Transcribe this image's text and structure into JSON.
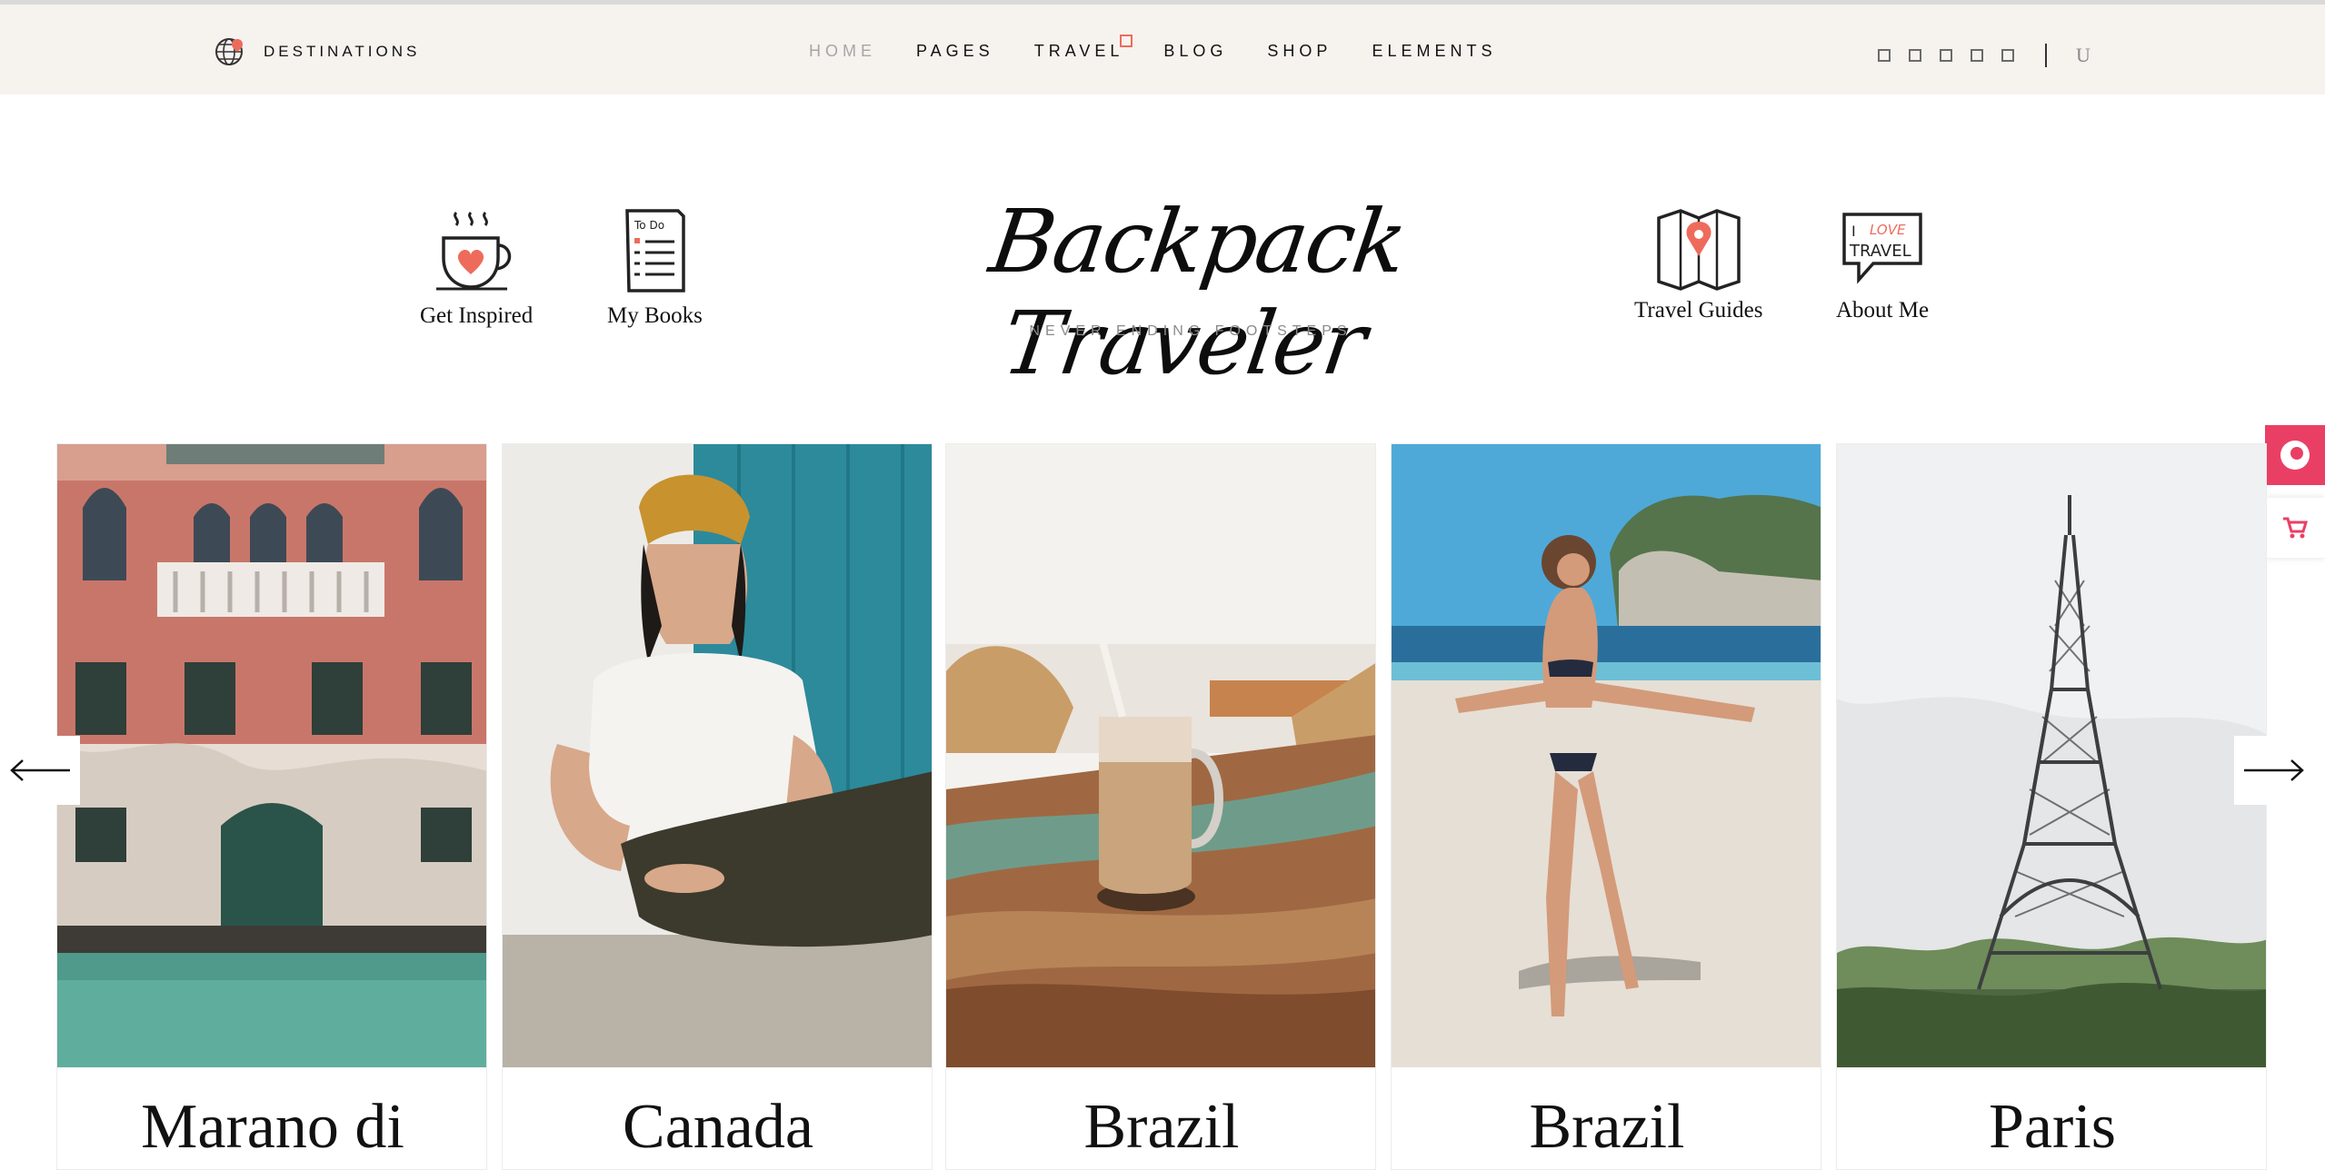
{
  "topbar": {
    "destinations_label": "DESTINATIONS",
    "nav": [
      "HOME",
      "PAGES",
      "TRAVEL",
      "BLOG",
      "SHOP",
      "ELEMENTS"
    ],
    "active_nav": "HOME",
    "social_icons": [
      "square-icon",
      "square-icon",
      "square-icon",
      "square-icon",
      "square-icon"
    ],
    "user_glyph": "U"
  },
  "header": {
    "quick_links": [
      "Get Inspired",
      "My Books",
      "Travel Guides",
      "About Me"
    ],
    "logo_text": "Backpack Traveler",
    "tagline": "NEVER ENDING FOOTSTEPS",
    "icon_texts": {
      "todo": "To Do",
      "love_line1": "I",
      "love_line2": "LOVE",
      "love_line3": "TRAVEL"
    }
  },
  "carousel": {
    "cards": [
      "Marano di",
      "Canada",
      "Brazil",
      "Brazil",
      "Paris"
    ],
    "prev_icon": "arrow-left-icon",
    "next_icon": "arrow-right-icon"
  },
  "side": {
    "icons": [
      "chat-icon",
      "cart-icon"
    ]
  },
  "colors": {
    "accent": "#ea3f64",
    "topbar_bg": "#f6f2ee",
    "coral": "#ee6b5b"
  }
}
